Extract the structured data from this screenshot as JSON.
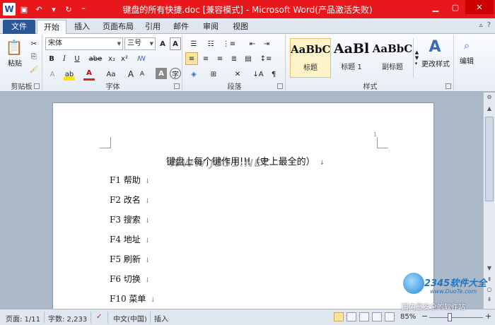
{
  "titlebar": {
    "title": "键盘的所有快捷.doc [兼容模式] - Microsoft Word(产品激活失败)",
    "app_icon": "W",
    "bg_color": "#e8171b"
  },
  "tabs": {
    "file": "文件",
    "items": [
      "开始",
      "插入",
      "页面布局",
      "引用",
      "邮件",
      "审阅",
      "视图"
    ],
    "active": "开始"
  },
  "ribbon": {
    "clipboard": {
      "label": "剪贴板",
      "paste": "粘贴"
    },
    "font": {
      "label": "字体",
      "font_name": "宋体",
      "font_size": "三号",
      "bold": "B",
      "italic": "I",
      "underline": "U",
      "strike": "abe",
      "sub": "x₂",
      "sup": "x²",
      "grow": "A",
      "shrink": "A",
      "case": "Aa"
    },
    "paragraph": {
      "label": "段落"
    },
    "styles": {
      "label": "样式",
      "items": [
        {
          "sample": "AaBbC",
          "name": "标题"
        },
        {
          "sample": "AaBl",
          "name": "标题 1"
        },
        {
          "sample": "AaBbC",
          "name": "副标题"
        }
      ],
      "change": "更改样式"
    },
    "editing": {
      "label": "编辑"
    }
  },
  "document": {
    "page_number": "1",
    "title": "键盘上每个键作用!!!（史上最全的）",
    "lines": [
      "F1 帮助",
      "F2 改名",
      "F3 搜索",
      "F4 地址",
      "F5 刷新",
      "F6 切换",
      "F10 菜单"
    ],
    "paragraph_mark": "↓",
    "watermark": "WWW.JB51.NET"
  },
  "status": {
    "page": "页面: 1/11",
    "words": "字数: 2,233",
    "language": "中文(中国)",
    "mode": "插入",
    "zoom": "85%"
  },
  "corner_logo": {
    "brand": "2345软件大全",
    "url": "www.DuoTe.com",
    "slogan": "国内最安全的软件站"
  }
}
